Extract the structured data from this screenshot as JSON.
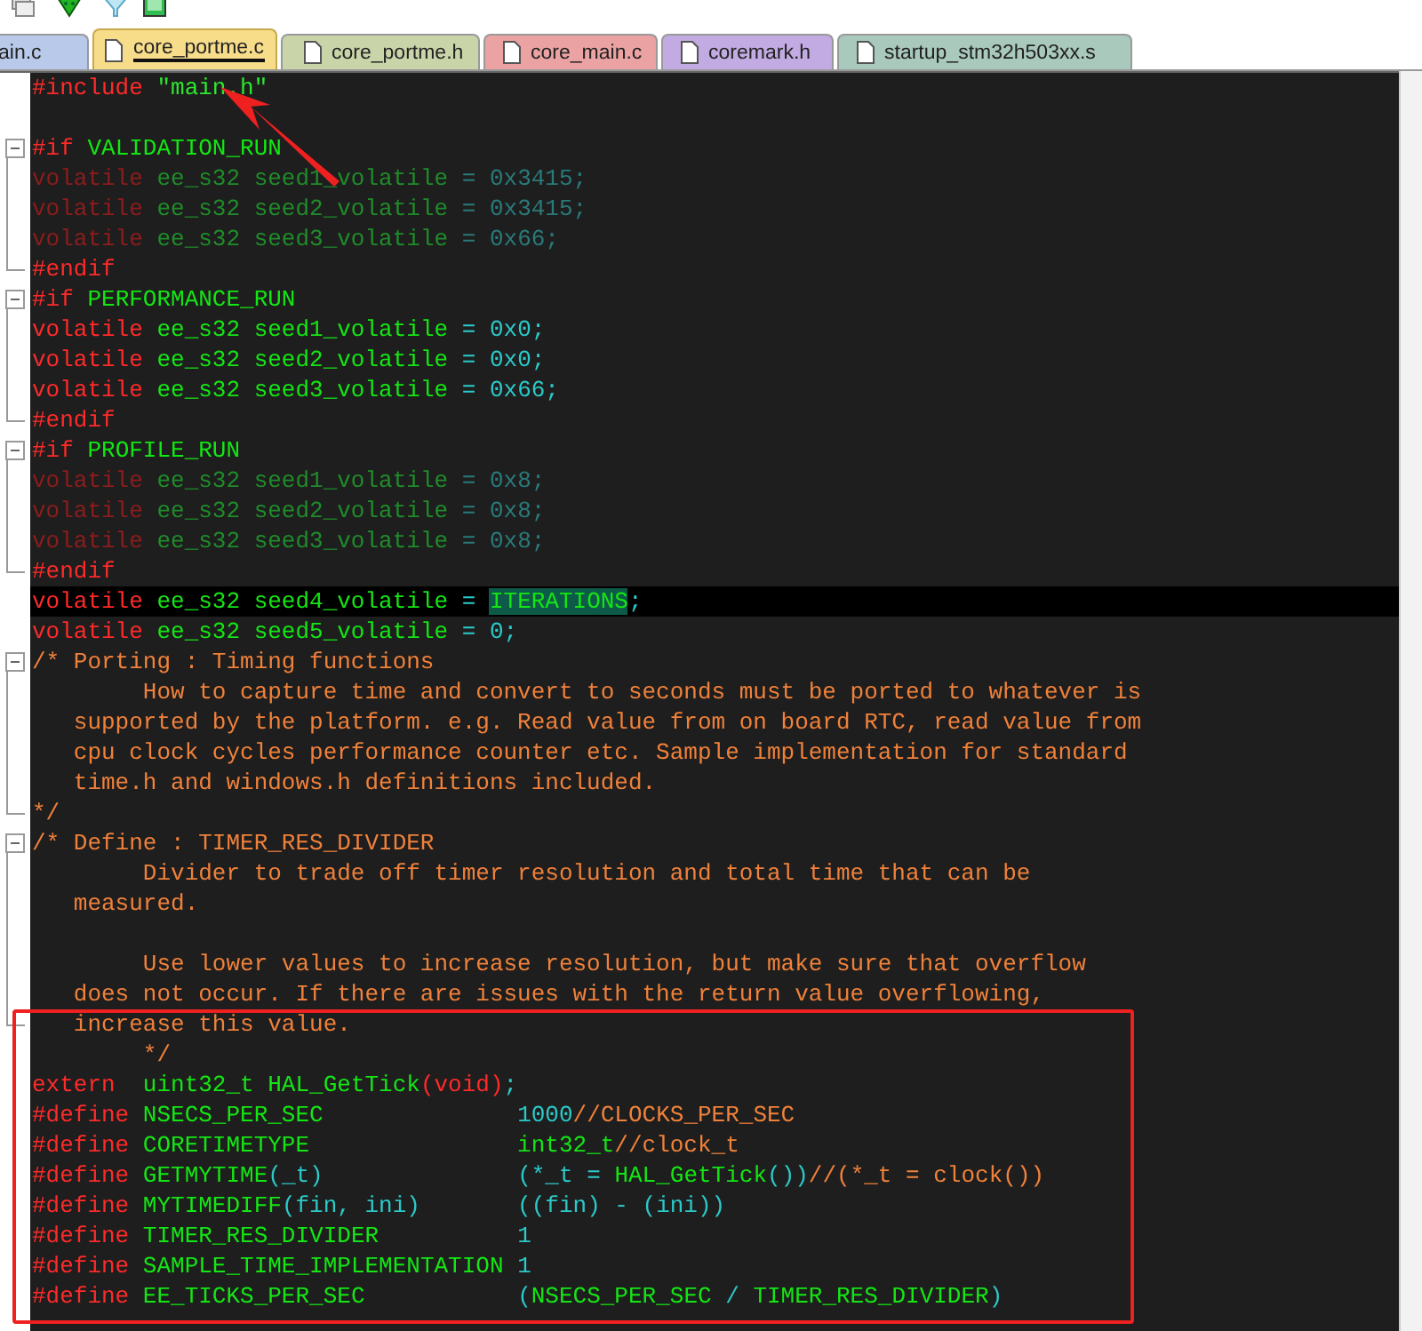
{
  "tabs": [
    {
      "label": "ain.c",
      "selected": false,
      "color": "#b9c9ea"
    },
    {
      "label": "core_portme.c",
      "selected": true,
      "color": "#f7dc8a"
    },
    {
      "label": "core_portme.h",
      "selected": false,
      "color": "#c9d5a9"
    },
    {
      "label": "core_main.c",
      "selected": false,
      "color": "#eaa2a2"
    },
    {
      "label": "coremark.h",
      "selected": false,
      "color": "#c2aae2"
    },
    {
      "label": "startup_stm32h503xx.s",
      "selected": false,
      "color": "#a9c9bd"
    }
  ],
  "editor": {
    "lines": [
      {
        "tokens": [
          {
            "text": "#include ",
            "kind": "kw"
          },
          {
            "text": "\"main.h\"",
            "kind": "str"
          }
        ]
      },
      {
        "kind": "blank"
      },
      {
        "kind": "fold",
        "expanded": true,
        "lines": [
          {
            "tokens": [
              {
                "text": "#if ",
                "kind": "kw"
              },
              {
                "text": "VALIDATION_RUN",
                "kind": "id"
              }
            ]
          },
          {
            "tokens": [
              {
                "text": "volatile ",
                "kind": "kw-off"
              },
              {
                "text": "ee_s32 seed1_volatile ",
                "kind": "id-off"
              },
              {
                "text": "= 0x3415;",
                "kind": "num-off"
              }
            ]
          },
          {
            "tokens": [
              {
                "text": "volatile ",
                "kind": "kw-off"
              },
              {
                "text": "ee_s32 seed2_volatile ",
                "kind": "id-off"
              },
              {
                "text": "= 0x3415;",
                "kind": "num-off"
              }
            ]
          },
          {
            "tokens": [
              {
                "text": "volatile ",
                "kind": "kw-off"
              },
              {
                "text": "ee_s32 seed3_volatile ",
                "kind": "id-off"
              },
              {
                "text": "= 0x66;",
                "kind": "num-off"
              }
            ]
          },
          {
            "tokens": [
              {
                "text": "#endif",
                "kind": "kw"
              }
            ]
          }
        ]
      },
      {
        "kind": "fold",
        "expanded": true,
        "lines": [
          {
            "tokens": [
              {
                "text": "#if ",
                "kind": "kw"
              },
              {
                "text": "PERFORMANCE_RUN",
                "kind": "id"
              }
            ]
          },
          {
            "tokens": [
              {
                "text": "volatile ",
                "kind": "kw"
              },
              {
                "text": "ee_s32 seed1_volatile ",
                "kind": "id"
              },
              {
                "text": "= 0x0;",
                "kind": "num"
              }
            ]
          },
          {
            "tokens": [
              {
                "text": "volatile ",
                "kind": "kw"
              },
              {
                "text": "ee_s32 seed2_volatile ",
                "kind": "id"
              },
              {
                "text": "= 0x0;",
                "kind": "num"
              }
            ]
          },
          {
            "tokens": [
              {
                "text": "volatile ",
                "kind": "kw"
              },
              {
                "text": "ee_s32 seed3_volatile ",
                "kind": "id"
              },
              {
                "text": "= 0x66;",
                "kind": "num"
              }
            ]
          },
          {
            "tokens": [
              {
                "text": "#endif",
                "kind": "kw"
              }
            ]
          }
        ]
      },
      {
        "kind": "fold",
        "expanded": true,
        "lines": [
          {
            "tokens": [
              {
                "text": "#if ",
                "kind": "kw"
              },
              {
                "text": "PROFILE_RUN",
                "kind": "id"
              }
            ]
          },
          {
            "tokens": [
              {
                "text": "volatile ",
                "kind": "kw-off"
              },
              {
                "text": "ee_s32 seed1_volatile ",
                "kind": "id-off"
              },
              {
                "text": "= 0x8;",
                "kind": "num-off"
              }
            ]
          },
          {
            "tokens": [
              {
                "text": "volatile ",
                "kind": "kw-off"
              },
              {
                "text": "ee_s32 seed2_volatile ",
                "kind": "id-off"
              },
              {
                "text": "= 0x8;",
                "kind": "num-off"
              }
            ]
          },
          {
            "tokens": [
              {
                "text": "volatile ",
                "kind": "kw-off"
              },
              {
                "text": "ee_s32 seed3_volatile ",
                "kind": "id-off"
              },
              {
                "text": "= 0x8;",
                "kind": "num-off"
              }
            ]
          },
          {
            "tokens": [
              {
                "text": "#endif",
                "kind": "kw"
              }
            ]
          }
        ]
      },
      {
        "current": true,
        "tokens": [
          {
            "text": "volatile ",
            "kind": "kw"
          },
          {
            "text": "ee_s32 seed4_volatile ",
            "kind": "id"
          },
          {
            "text": "= ",
            "kind": "num"
          },
          {
            "text": "ITERATIONS",
            "kind": "match"
          },
          {
            "text": ";",
            "kind": "num"
          }
        ]
      },
      {
        "tokens": [
          {
            "text": "volatile ",
            "kind": "kw"
          },
          {
            "text": "ee_s32 seed5_volatile ",
            "kind": "id"
          },
          {
            "text": "= 0;",
            "kind": "num"
          }
        ]
      },
      {
        "kind": "fold",
        "expanded": true,
        "lines": [
          {
            "tokens": [
              {
                "text": "/* Porting : Timing functions",
                "kind": "cm"
              }
            ]
          },
          {
            "tokens": [
              {
                "text": "        How to capture time and convert to seconds must be ported to whatever is",
                "kind": "cm"
              }
            ]
          },
          {
            "tokens": [
              {
                "text": "   supported by the platform. e.g. Read value from on board RTC, read value from",
                "kind": "cm"
              }
            ]
          },
          {
            "tokens": [
              {
                "text": "   cpu clock cycles performance counter etc. Sample implementation for standard",
                "kind": "cm"
              }
            ]
          },
          {
            "tokens": [
              {
                "text": "   time.h and windows.h definitions included.",
                "kind": "cm"
              }
            ]
          },
          {
            "tokens": [
              {
                "text": "*/",
                "kind": "cm"
              }
            ]
          }
        ]
      },
      {
        "kind": "fold",
        "expanded": true,
        "lines": [
          {
            "tokens": [
              {
                "text": "/* Define : TIMER_RES_DIVIDER",
                "kind": "cm"
              }
            ]
          },
          {
            "tokens": [
              {
                "text": "        Divider to trade off timer resolution and total time that can be",
                "kind": "cm"
              }
            ]
          },
          {
            "tokens": [
              {
                "text": "   measured.",
                "kind": "cm"
              }
            ]
          },
          {
            "kind": "blank"
          },
          {
            "tokens": [
              {
                "text": "        Use lower values to increase resolution, but make sure that overflow",
                "kind": "cm"
              }
            ]
          },
          {
            "tokens": [
              {
                "text": "   does not occur. If there are issues with the return value overflowing,",
                "kind": "cm"
              }
            ]
          },
          {
            "tokens": [
              {
                "text": "   increase this value.",
                "kind": "cm"
              }
            ]
          }
        ]
      },
      {
        "tokens": [
          {
            "text": "        */",
            "kind": "cm"
          }
        ]
      },
      {
        "tokens": [
          {
            "text": "extern  ",
            "kind": "kw"
          },
          {
            "text": "uint32_t HAL_GetTick",
            "kind": "id"
          },
          {
            "text": "(void)",
            "kind": "kw"
          },
          {
            "text": ";",
            "kind": "num"
          }
        ]
      },
      {
        "tokens": [
          {
            "text": "#define ",
            "kind": "kw"
          },
          {
            "text": "NSECS_PER_SEC              ",
            "kind": "id"
          },
          {
            "text": "1000",
            "kind": "num"
          },
          {
            "text": "//CLOCKS_PER_SEC",
            "kind": "cm"
          }
        ]
      },
      {
        "tokens": [
          {
            "text": "#define ",
            "kind": "kw"
          },
          {
            "text": "CORETIMETYPE               int32_t",
            "kind": "id"
          },
          {
            "text": "//clock_t",
            "kind": "cm"
          }
        ]
      },
      {
        "tokens": [
          {
            "text": "#define ",
            "kind": "kw"
          },
          {
            "text": "GETMYTIME",
            "kind": "id"
          },
          {
            "text": "(_t)              (*_t = ",
            "kind": "num"
          },
          {
            "text": "HAL_GetTick",
            "kind": "id"
          },
          {
            "text": "())",
            "kind": "num"
          },
          {
            "text": "//(*_t = clock())",
            "kind": "cm"
          }
        ]
      },
      {
        "tokens": [
          {
            "text": "#define ",
            "kind": "kw"
          },
          {
            "text": "MYTIMEDIFF",
            "kind": "id"
          },
          {
            "text": "(fin, ini)       ((fin) - (ini))",
            "kind": "num"
          }
        ]
      },
      {
        "tokens": [
          {
            "text": "#define ",
            "kind": "kw"
          },
          {
            "text": "TIMER_RES_DIVIDER          ",
            "kind": "id"
          },
          {
            "text": "1",
            "kind": "num"
          }
        ]
      },
      {
        "tokens": [
          {
            "text": "#define ",
            "kind": "kw"
          },
          {
            "text": "SAMPLE_TIME_IMPLEMENTATION ",
            "kind": "id"
          },
          {
            "text": "1",
            "kind": "num"
          }
        ]
      },
      {
        "tokens": [
          {
            "text": "#define ",
            "kind": "kw"
          },
          {
            "text": "EE_TICKS_PER_SEC           ",
            "kind": "id"
          },
          {
            "text": "(",
            "kind": "num"
          },
          {
            "text": "NSECS_PER_SEC",
            "kind": "id"
          },
          {
            "text": " / ",
            "kind": "num"
          },
          {
            "text": "TIMER_RES_DIVIDER",
            "kind": "id"
          },
          {
            "text": ")",
            "kind": "num"
          }
        ]
      }
    ]
  }
}
